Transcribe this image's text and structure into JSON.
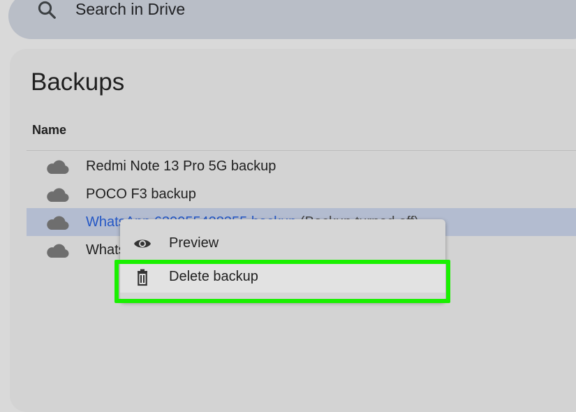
{
  "search": {
    "placeholder": "Search in Drive"
  },
  "page": {
    "title": "Backups",
    "column_name": "Name"
  },
  "backups": [
    {
      "name": "Redmi Note 13 Pro 5G backup",
      "suffix": ""
    },
    {
      "name": "POCO F3 backup",
      "suffix": ""
    },
    {
      "name": "WhatsApp 639955428355 backup",
      "suffix": " (Backup turned off)"
    },
    {
      "name": "WhatsApp",
      "suffix": ""
    }
  ],
  "context_menu": {
    "items": [
      {
        "label": "Preview",
        "icon": "eye-icon"
      },
      {
        "label": "Delete backup",
        "icon": "trash-icon"
      }
    ]
  },
  "colors": {
    "highlight": "#19f000",
    "selected_row": "#b3bcd0",
    "selected_text": "#2457c5"
  }
}
